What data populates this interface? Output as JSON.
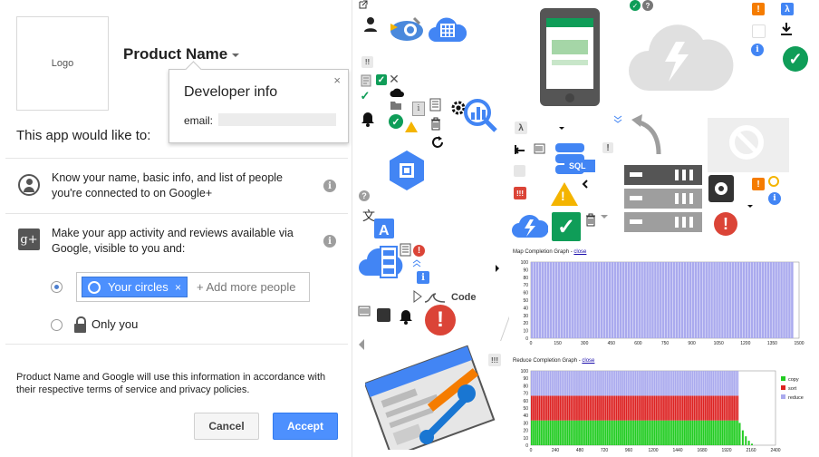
{
  "consent": {
    "logo_label": "Logo",
    "product_name": "Product Name",
    "popup": {
      "title": "Developer info",
      "email_label": "email:",
      "close_glyph": "×"
    },
    "intro": "This app would like to:",
    "permissions": [
      {
        "line1": "Know your name, basic info, and list of people",
        "line2": "you're connected to on Google+"
      },
      {
        "line1": "Make your app activity and reviews available via",
        "line2": "Google, visible to you and:"
      }
    ],
    "visibility": {
      "chip_label": "Your circles",
      "chip_remove": "×",
      "add_more": "+ Add more people",
      "only_you": "Only you",
      "selected": "Your circles"
    },
    "footer_line1": "Product Name and Google will use this information in accordance with",
    "footer_line2": "their respective terms of service and privacy policies.",
    "cancel_label": "Cancel",
    "accept_label": "Accept",
    "gplus_glyph": "g+",
    "info_glyph": "i"
  },
  "collage": {
    "sql_label": "SQL",
    "code_label": "Code",
    "lambda": "λ",
    "exclaim": "!",
    "dbl_exclaim": "!!",
    "triple_exclaim": "!!!",
    "question": "?",
    "info": "i",
    "check": "✓",
    "cross": "✕",
    "colors": {
      "blue": "#4285f4",
      "red": "#db4437",
      "green": "#0f9d58",
      "yellow": "#f4b400",
      "grey": "#9e9e9e"
    }
  },
  "chart_data": [
    {
      "type": "bar",
      "title": "Map Completion Graph",
      "link": "close",
      "x_ticks": [
        "0",
        "150",
        "300",
        "450",
        "600",
        "750",
        "900",
        "1050",
        "1200",
        "1350",
        "1500"
      ],
      "y_ticks": [
        "0",
        "10",
        "20",
        "30",
        "40",
        "50",
        "60",
        "70",
        "80",
        "90",
        "100"
      ],
      "xlim": [
        0,
        1500
      ],
      "ylim": [
        0,
        100
      ],
      "series": [
        {
          "values_description": "all map tasks",
          "x_range": [
            0,
            1470
          ],
          "value": 100,
          "color": "#aaaaee"
        }
      ]
    },
    {
      "type": "bar",
      "title": "Reduce Completion Graph",
      "link": "close",
      "x_ticks": [
        "0",
        "240",
        "480",
        "720",
        "960",
        "1200",
        "1440",
        "1680",
        "1920",
        "2160",
        "2400"
      ],
      "y_ticks": [
        "0",
        "10",
        "20",
        "30",
        "40",
        "50",
        "60",
        "70",
        "80",
        "90",
        "100"
      ],
      "xlim": [
        0,
        2400
      ],
      "ylim": [
        0,
        100
      ],
      "legend": [
        "copy",
        "sort",
        "reduce"
      ],
      "legend_colors": [
        "#22cc22",
        "#dd2222",
        "#aaaaee"
      ],
      "stack": {
        "copy": 33.3,
        "sort": 33.3,
        "reduce": 33.3
      },
      "stack_x_range": [
        0,
        2040
      ],
      "tail": [
        [
          2040,
          30
        ],
        [
          2070,
          20
        ],
        [
          2100,
          12
        ],
        [
          2130,
          6
        ],
        [
          2160,
          2
        ]
      ]
    }
  ]
}
